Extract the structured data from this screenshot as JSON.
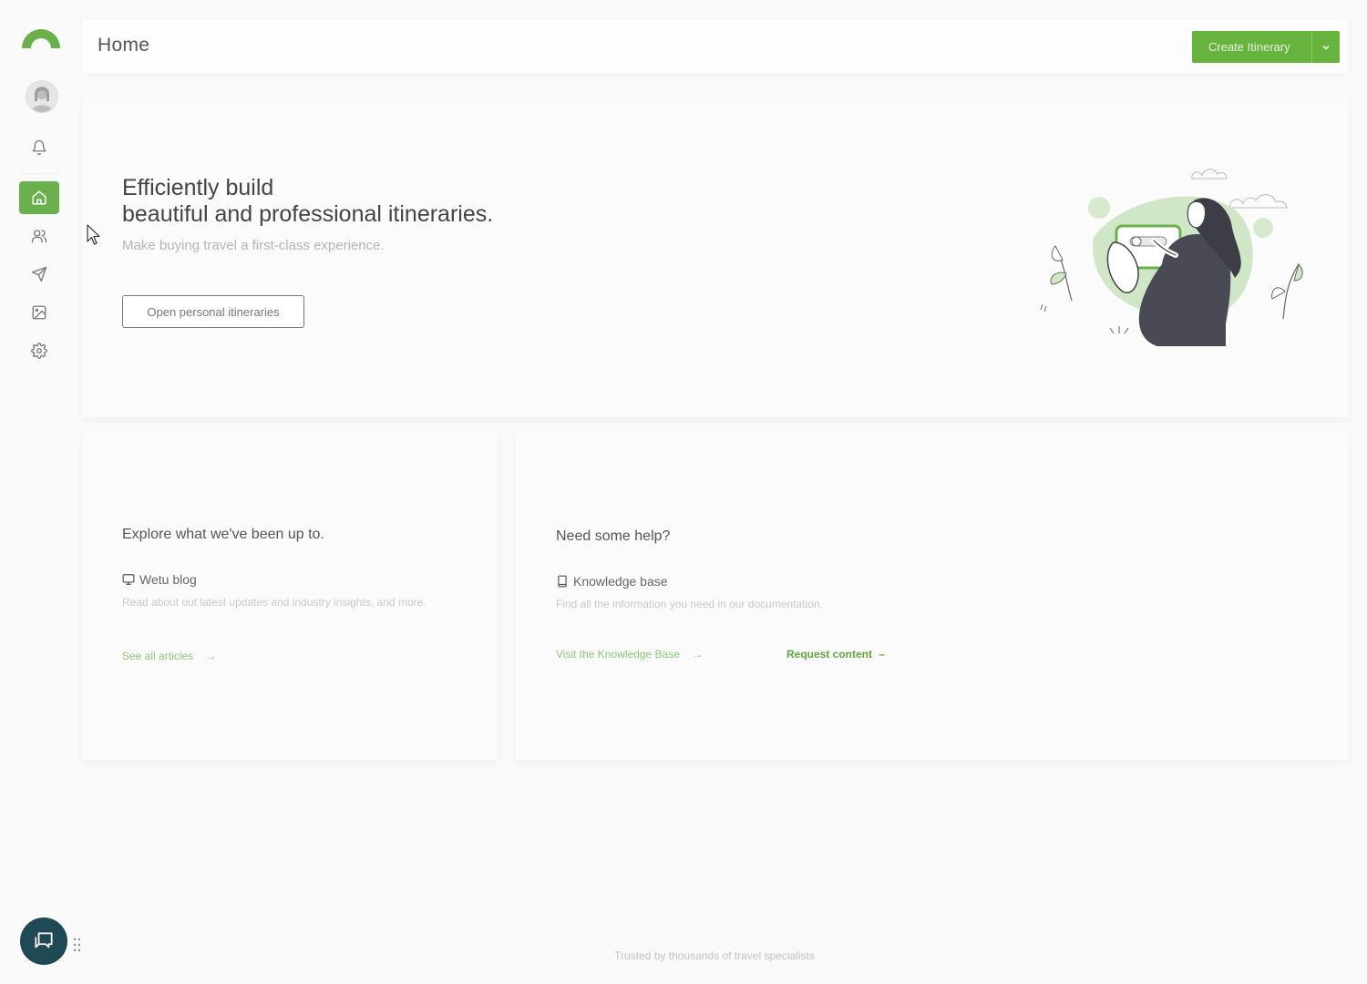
{
  "header": {
    "title": "Home",
    "create_label": "Create Itinerary"
  },
  "sidebar": {
    "items": [
      {
        "name": "notifications",
        "icon": "bell-icon"
      },
      {
        "name": "home",
        "icon": "home-icon",
        "active": true
      },
      {
        "name": "contacts",
        "icon": "users-icon"
      },
      {
        "name": "send",
        "icon": "send-icon"
      },
      {
        "name": "media",
        "icon": "image-icon"
      },
      {
        "name": "settings",
        "icon": "gear-icon"
      }
    ]
  },
  "hero": {
    "title_line1": "Efficiently build",
    "title_line2": "beautiful and professional itineraries.",
    "subtitle": "Make buying travel a first-class experience.",
    "button_label": "Open personal itineraries"
  },
  "cards": {
    "left": {
      "title": "Explore what we've been up to.",
      "item_label": "Wetu blog",
      "item_icon": "monitor-icon",
      "description": "Read about out latest updates and industry insights, and more.",
      "link_label": "See all articles"
    },
    "right": {
      "title": "Need some help?",
      "item_label": "Knowledge base",
      "item_icon": "book-icon",
      "description": "Find all the information you need in our documentation.",
      "link1_label": "Visit the Knowledge Base",
      "link2_label": "Request content"
    }
  },
  "footer": {
    "text": "Trusted by thousands of travel specialists"
  },
  "colors": {
    "accent": "#66b43e",
    "chat": "#1f4a55"
  }
}
